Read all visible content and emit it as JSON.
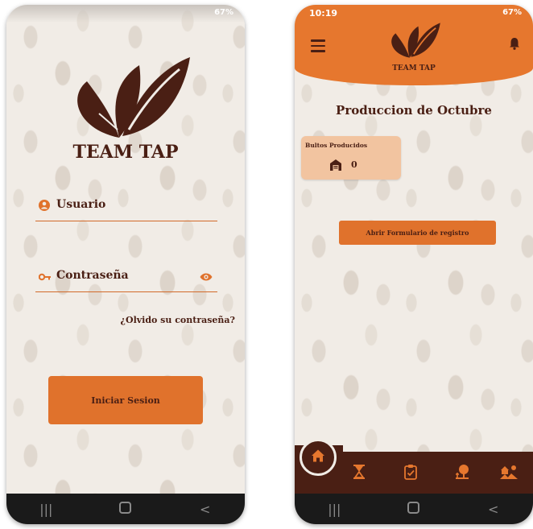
{
  "login_screen": {
    "status_bar": {
      "time": "",
      "indicators": "67%"
    },
    "brand": "TEAM TAP",
    "username_field": {
      "label": "Usuario",
      "icon": "user-circle-icon"
    },
    "password_field": {
      "label": "Contraseña",
      "icon": "key-icon",
      "toggle_icon": "eye-icon"
    },
    "forgot_password": "¿Olvido su contraseña?",
    "login_button": "Iniciar Sesion",
    "nav": {
      "recents": "|||",
      "home": "○",
      "back": "<"
    }
  },
  "dashboard_screen": {
    "status_bar": {
      "time": "10:19",
      "indicators": "67%"
    },
    "header": {
      "brand": "TEAM TAP",
      "menu_icon": "hamburger-icon",
      "notification_icon": "bell-icon"
    },
    "title": "Produccion de Octubre",
    "stat_card": {
      "label": "Bultos Producidos",
      "value": "0",
      "icon": "warehouse-icon"
    },
    "open_form_button": "Abrir Formulario de registro",
    "bottom_tabs": [
      {
        "name": "home",
        "icon": "home-icon",
        "active": true
      },
      {
        "name": "harvest",
        "icon": "hourglass-icon",
        "active": false
      },
      {
        "name": "checklist",
        "icon": "clipboard-check-icon",
        "active": false
      },
      {
        "name": "plant",
        "icon": "plant-icon",
        "active": false
      },
      {
        "name": "farm",
        "icon": "farm-icon",
        "active": false
      }
    ],
    "nav": {
      "recents": "|||",
      "home": "○",
      "back": "<"
    }
  },
  "colors": {
    "primary_orange": "#e0722c",
    "dark_brown": "#4a1f14",
    "card_bg": "#f2c4a0",
    "background": "#f1ece6"
  }
}
